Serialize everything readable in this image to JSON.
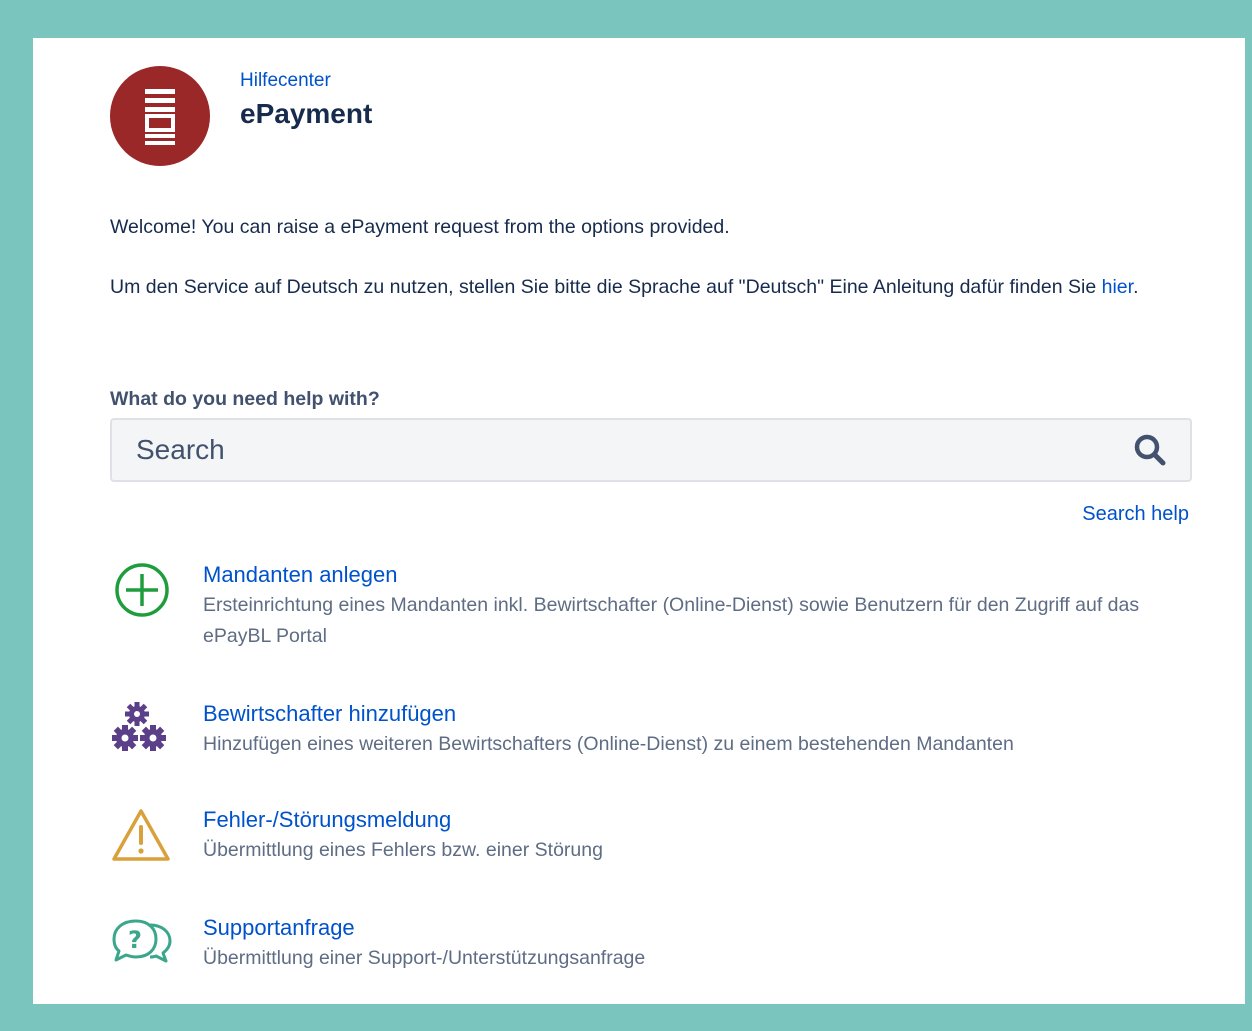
{
  "header": {
    "breadcrumb": "Hilfecenter",
    "title": "ePayment",
    "logo_color": "#9b2828"
  },
  "intro": {
    "welcome": "Welcome! You can raise a ePayment request from the options provided.",
    "language_note": "Um den Service auf Deutsch zu nutzen, stellen Sie bitte die Sprache auf \"Deutsch\" Eine Anleitung dafür finden Sie ",
    "language_link": "hier",
    "language_suffix": "."
  },
  "search": {
    "label": "What do you need help with?",
    "placeholder": "Search",
    "help_link": "Search help"
  },
  "options": [
    {
      "icon": "plus-circle-icon",
      "title": "Mandanten anlegen",
      "description": "Ersteinrichtung eines Mandanten inkl. Bewirtschafter (Online-Dienst) sowie Benutzern für den Zugriff auf das ePayBL Portal",
      "color": "#1f9d3d"
    },
    {
      "icon": "gears-icon",
      "title": "Bewirtschafter hinzufügen",
      "description": "Hinzufügen eines weiteren Bewirtschafters (Online-Dienst) zu einem bestehenden Mandanten",
      "color": "#5b3f88"
    },
    {
      "icon": "warning-icon",
      "title": "Fehler-/Störungsmeldung",
      "description": "Übermittlung eines Fehlers bzw. einer Störung",
      "color": "#d9a13b"
    },
    {
      "icon": "question-bubbles-icon",
      "title": "Supportanfrage",
      "description": "Übermittlung einer Support-/Unterstützungsanfrage",
      "color": "#3aa68c"
    }
  ],
  "colors": {
    "frame": "#7ac6bf",
    "link": "#0052cc"
  }
}
